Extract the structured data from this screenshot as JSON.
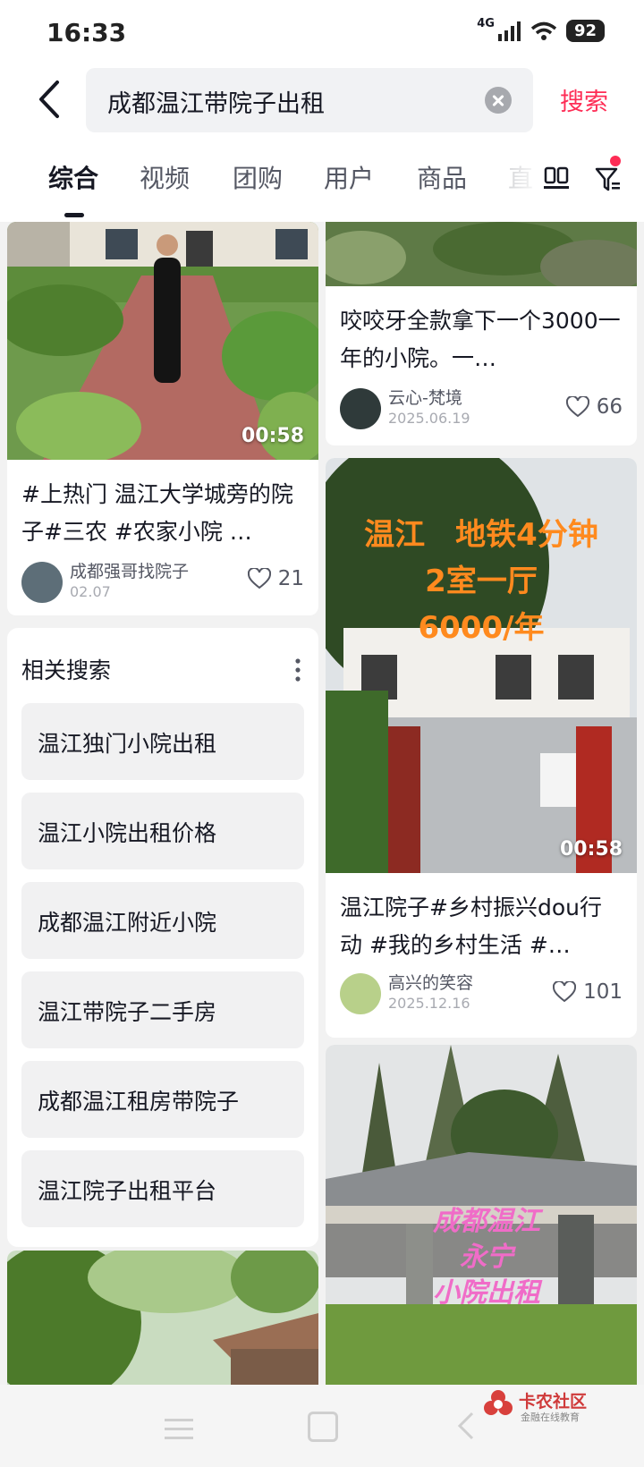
{
  "status_bar": {
    "time": "16:33",
    "network": "4G",
    "battery": "92"
  },
  "search": {
    "query": "成都温江带院子出租",
    "button_label": "搜索"
  },
  "tabs": [
    {
      "label": "综合",
      "active": true
    },
    {
      "label": "视频",
      "active": false
    },
    {
      "label": "团购",
      "active": false
    },
    {
      "label": "用户",
      "active": false
    },
    {
      "label": "商品",
      "active": false
    },
    {
      "label": "直",
      "active": false
    }
  ],
  "left_column": {
    "card1": {
      "duration": "00:58",
      "title": "#上热门 温江大学城旁的院子#三农 #农家小院 …",
      "author": "成都强哥找院子",
      "date": "02.07",
      "likes": "21"
    },
    "related": {
      "title": "相关搜索",
      "items": [
        "温江独门小院出租",
        "温江小院出租价格",
        "成都温江附近小院",
        "温江带院子二手房",
        "成都温江租房带院子",
        "温江院子出租平台"
      ]
    }
  },
  "right_column": {
    "card1": {
      "title": "咬咬牙全款拿下一个3000一年的小院。一…",
      "author": "云心-梵境",
      "date": "2025.06.19",
      "likes": "66"
    },
    "card2": {
      "overlay_line1": "温江　地铁4分钟",
      "overlay_line2": "2室一厅",
      "overlay_line3": "6000/年",
      "duration": "00:58",
      "title": "温江院子#乡村振兴dou行动 #我的乡村生活 #…",
      "author": "高兴的笑容",
      "date": "2025.12.16",
      "likes": "101"
    },
    "card3": {
      "overlay_line1": "成都温江",
      "overlay_line2": "永宁",
      "overlay_line3": "小院出租"
    }
  },
  "watermark": {
    "name": "卡农社区",
    "sub": "金融在线教育"
  },
  "colors": {
    "accent": "#fe2c55",
    "overlay_orange": "#ff8a1e",
    "overlay_pink": "#f06cc8"
  }
}
